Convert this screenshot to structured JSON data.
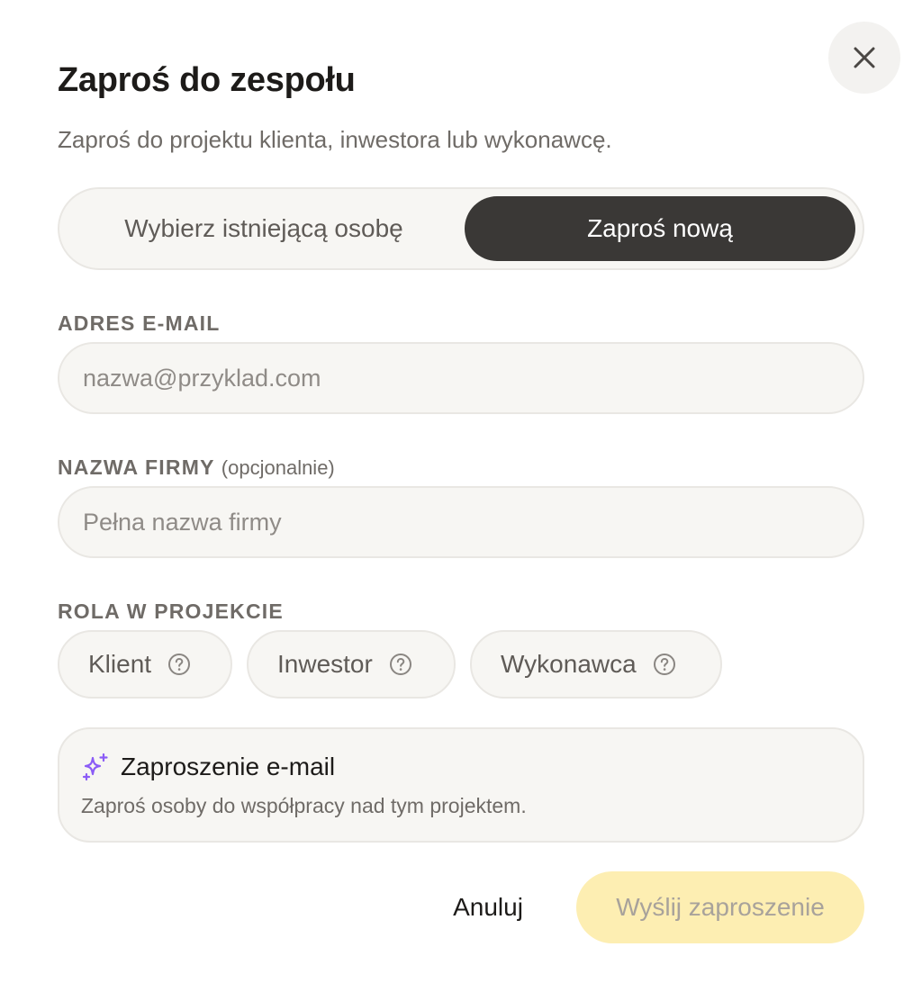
{
  "dialog": {
    "title": "Zaproś do zespołu",
    "subtitle": "Zaproś do projektu klienta, inwestora lub wykonawcę.",
    "close_icon": "close-icon"
  },
  "mode_toggle": {
    "options": [
      {
        "label": "Wybierz istniejącą osobę",
        "selected": false
      },
      {
        "label": "Zaproś nową",
        "selected": true
      }
    ]
  },
  "email": {
    "label": "ADRES E-MAIL",
    "value": "",
    "placeholder": "nazwa@przyklad.com"
  },
  "company": {
    "label": "NAZWA FIRMY",
    "optional_note": "(opcjonalnie)",
    "value": "",
    "placeholder": "Pełna nazwa firmy"
  },
  "role": {
    "label": "ROLA W PROJEKCIE",
    "options": [
      {
        "label": "Klient",
        "icon": "help-circle-icon"
      },
      {
        "label": "Inwestor",
        "icon": "help-circle-icon"
      },
      {
        "label": "Wykonawca",
        "icon": "help-circle-icon"
      }
    ]
  },
  "info_card": {
    "icon": "sparkles-icon",
    "title": "Zaproszenie e-mail",
    "description": "Zaproś osoby do współpracy nad tym projektem."
  },
  "footer": {
    "cancel_label": "Anuluj",
    "send_label": "Wyślij zaproszenie"
  },
  "colors": {
    "accent_dark": "#3a3836",
    "primary_button_disabled": "#fdeeb2",
    "sparkle_icon": "#8b5cf6"
  }
}
